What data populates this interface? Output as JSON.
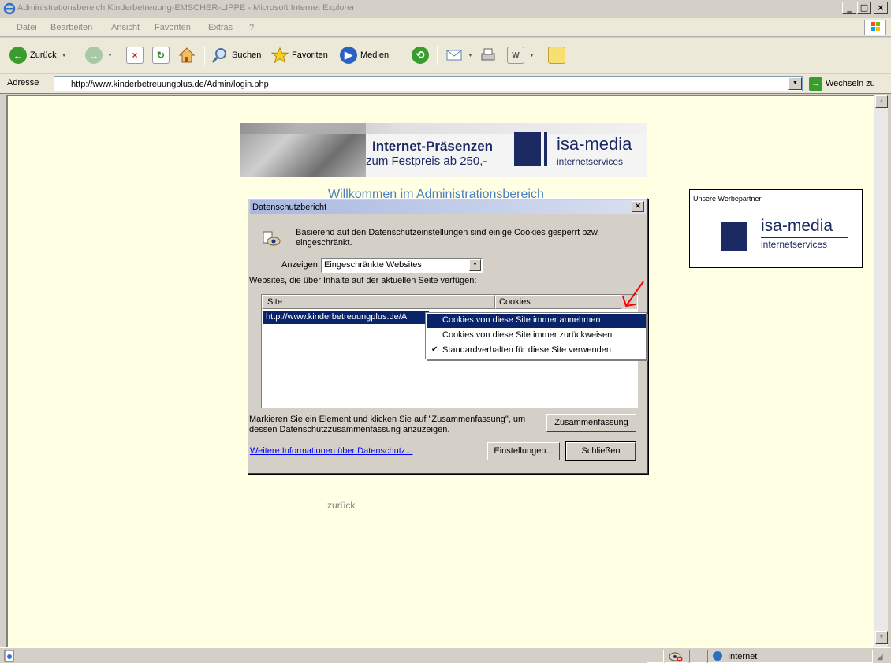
{
  "window": {
    "title": "Administrationsbereich Kinderbetreuung-EMSCHER-LIPPE - Microsoft Internet Explorer"
  },
  "menubar": {
    "items": [
      "Datei",
      "Bearbeiten",
      "Ansicht",
      "Favoriten",
      "Extras",
      "?"
    ]
  },
  "toolbar": {
    "back_label": "Zurück",
    "search_label": "Suchen",
    "favorites_label": "Favoriten",
    "media_label": "Medien"
  },
  "addressbar": {
    "label": "Adresse",
    "url": "http://www.kinderbetreuungplus.de/Admin/login.php",
    "go_label": "Wechseln zu"
  },
  "page": {
    "banner_line1": "Internet-Präsenzen",
    "banner_line2": "zum Festpreis ab 250,-",
    "banner_logo_name": "isa-media",
    "banner_logo_sub": "internetservices",
    "welcome": "Willkommen im Administrationsbereich",
    "back_link": "zurück",
    "partner_title": "Unsere Werbepartner:",
    "partner_logo_name": "isa-media",
    "partner_logo_sub": "internetservices"
  },
  "dialog": {
    "title": "Datenschutzbericht",
    "message": "Basierend auf den Datenschutzeinstellungen sind einige Cookies gesperrt bzw. eingeschränkt.",
    "show_label": "Anzeigen:",
    "show_value": "Eingeschränkte Websites",
    "websites_label": "Websites, die über Inhalte auf der aktuellen Seite verfügen:",
    "col_site": "Site",
    "col_cookies": "Cookies",
    "row_site": "http://www.kinderbetreuungplus.de/A",
    "hint": "Markieren Sie ein Element und klicken Sie auf \"Zusammenfassung\", um dessen Datenschutzzusammenfassung anzuzeigen.",
    "summary_button": "Zusammenfassung",
    "more_info_link": "Weitere Informationen über Datenschutz...",
    "settings_button": "Einstellungen...",
    "close_button": "Schließen"
  },
  "context_menu": {
    "items": [
      "Cookies von diese Site immer annehmen",
      "Cookies von diese Site immer zurückweisen",
      "Standardverhalten für diese Site verwenden"
    ],
    "highlighted_index": 0,
    "checked_index": 2
  },
  "statusbar": {
    "zone": "Internet"
  },
  "colors": {
    "selection": "#0a246a",
    "page_background": "#ffffe4",
    "brand_navy": "#1c2a63",
    "annotation_arrow": "#ff0000"
  }
}
